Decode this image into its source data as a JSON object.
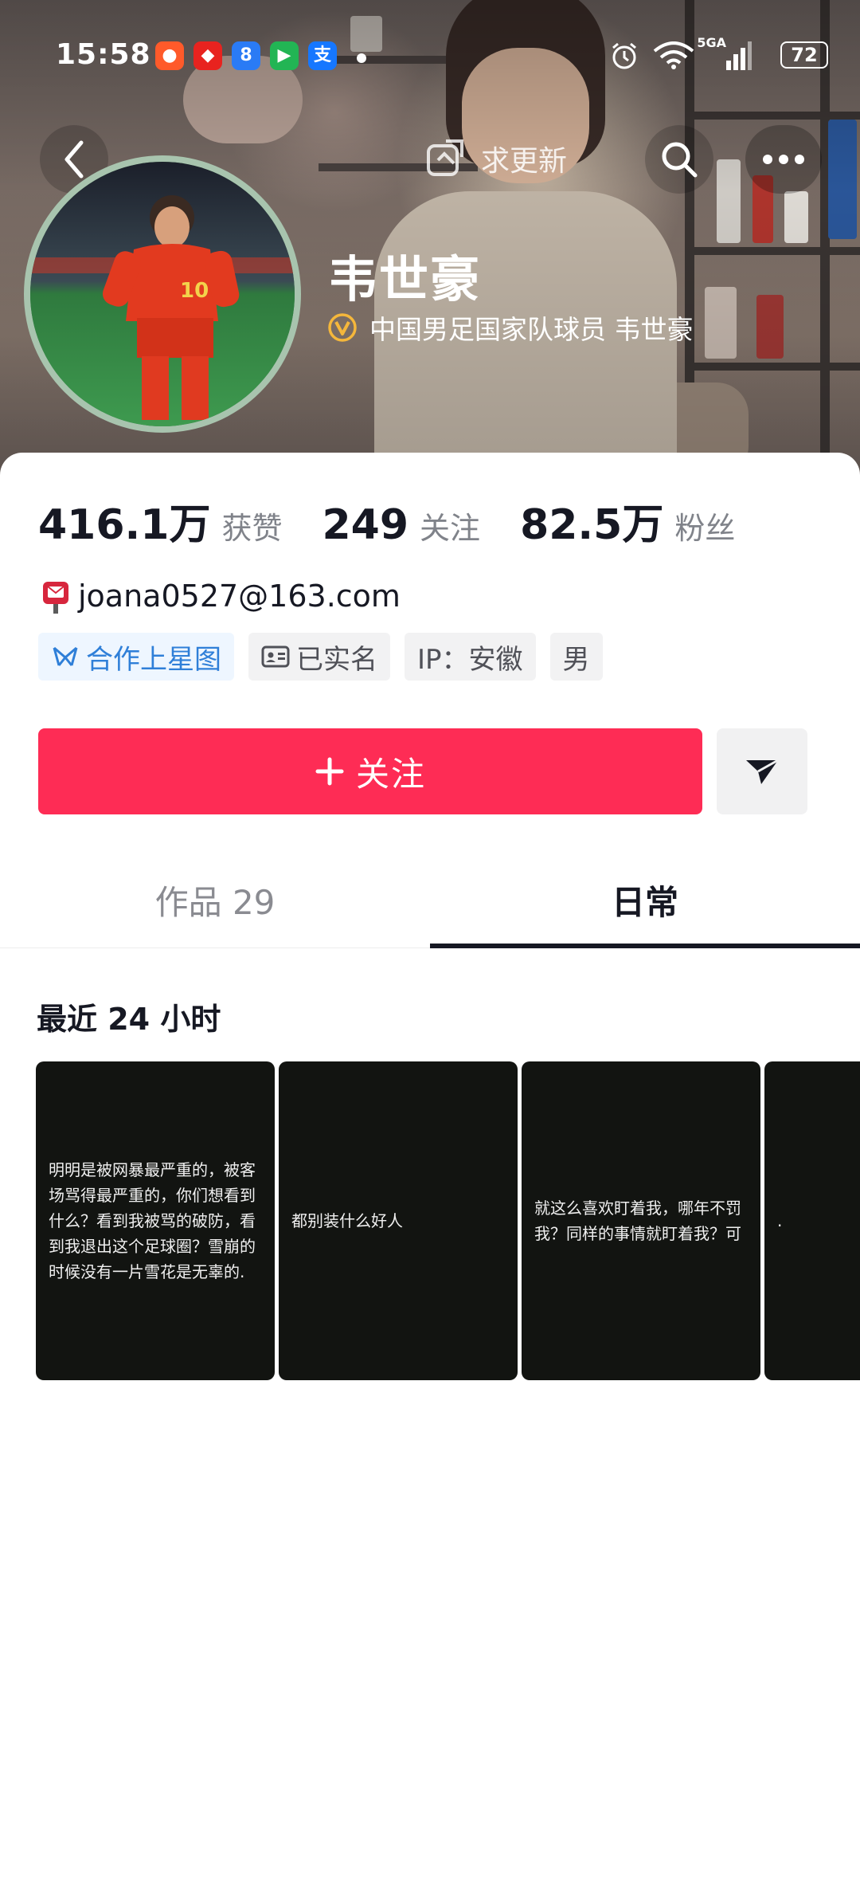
{
  "status_bar": {
    "time": "15:58",
    "apps": [
      {
        "name": "app-icon-1",
        "glyph": "",
        "color": "#ff5a2a"
      },
      {
        "name": "app-icon-2",
        "glyph": "",
        "color": "#e8231f"
      },
      {
        "name": "app-icon-3",
        "glyph": "8",
        "color": "#2a7bf5"
      },
      {
        "name": "app-icon-4",
        "glyph": "",
        "color": "#22b554"
      },
      {
        "name": "alipay-icon",
        "glyph": "支",
        "color": "#1677ff"
      }
    ],
    "network": "5GA",
    "battery": "72"
  },
  "nav": {
    "update_label": "求更新"
  },
  "profile": {
    "name": "韦世豪",
    "verified_text": "中国男足国家队球员 韦世豪",
    "stats": [
      {
        "value": "416.1万",
        "label": "获赞"
      },
      {
        "value": "249",
        "label": "关注"
      },
      {
        "value": "82.5万",
        "label": "粉丝"
      }
    ],
    "email": "joana0527@163.com",
    "tags": [
      {
        "label": "合作上星图",
        "icon": "xingtu-icon"
      },
      {
        "label": "已实名",
        "icon": "id-card-icon"
      },
      {
        "label": "IP：安徽",
        "icon": ""
      },
      {
        "label": "男",
        "icon": ""
      }
    ]
  },
  "actions": {
    "follow_label": "关注"
  },
  "tabs": [
    {
      "label": "作品 29",
      "active": false
    },
    {
      "label": "日常",
      "active": true
    }
  ],
  "recent": {
    "title": "最近 24 小时",
    "stories": [
      {
        "text": "明明是被网暴最严重的，被客场骂得最严重的，你们想看到什么？看到我被骂的破防，看到我退出这个足球圈？雪崩的时候没有一片雪花是无辜的."
      },
      {
        "text": "都别装什么好人"
      },
      {
        "text": "就这么喜欢盯着我，哪年不罚我？同样的事情就盯着我？可"
      },
      {
        "text": "."
      }
    ]
  },
  "colors": {
    "accent": "#fe2c55",
    "star_blue": "#2f7fd8",
    "verified_gold": "#f5b73b"
  }
}
